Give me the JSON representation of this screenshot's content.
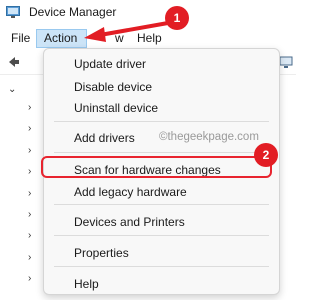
{
  "window": {
    "title": "Device Manager",
    "icon": "device-manager-icon"
  },
  "menubar": {
    "file": "File",
    "action": "Action",
    "view_fragment": "w",
    "help": "Help"
  },
  "action_menu": {
    "items": {
      "update_driver": "Update driver",
      "disable_device": "Disable device",
      "uninstall_device": "Uninstall device",
      "add_drivers": "Add drivers",
      "scan_hardware": "Scan for hardware changes",
      "add_legacy": "Add legacy hardware",
      "devices_printers": "Devices and Printers",
      "properties": "Properties",
      "help": "Help"
    }
  },
  "annotations": {
    "step1": "1",
    "step2": "2",
    "watermark": "©thegeekpage.com",
    "marker_color": "#e21d24"
  },
  "colors": {
    "menu_highlight": "#cce4f7",
    "menu_highlight_border": "#99c9ef"
  }
}
